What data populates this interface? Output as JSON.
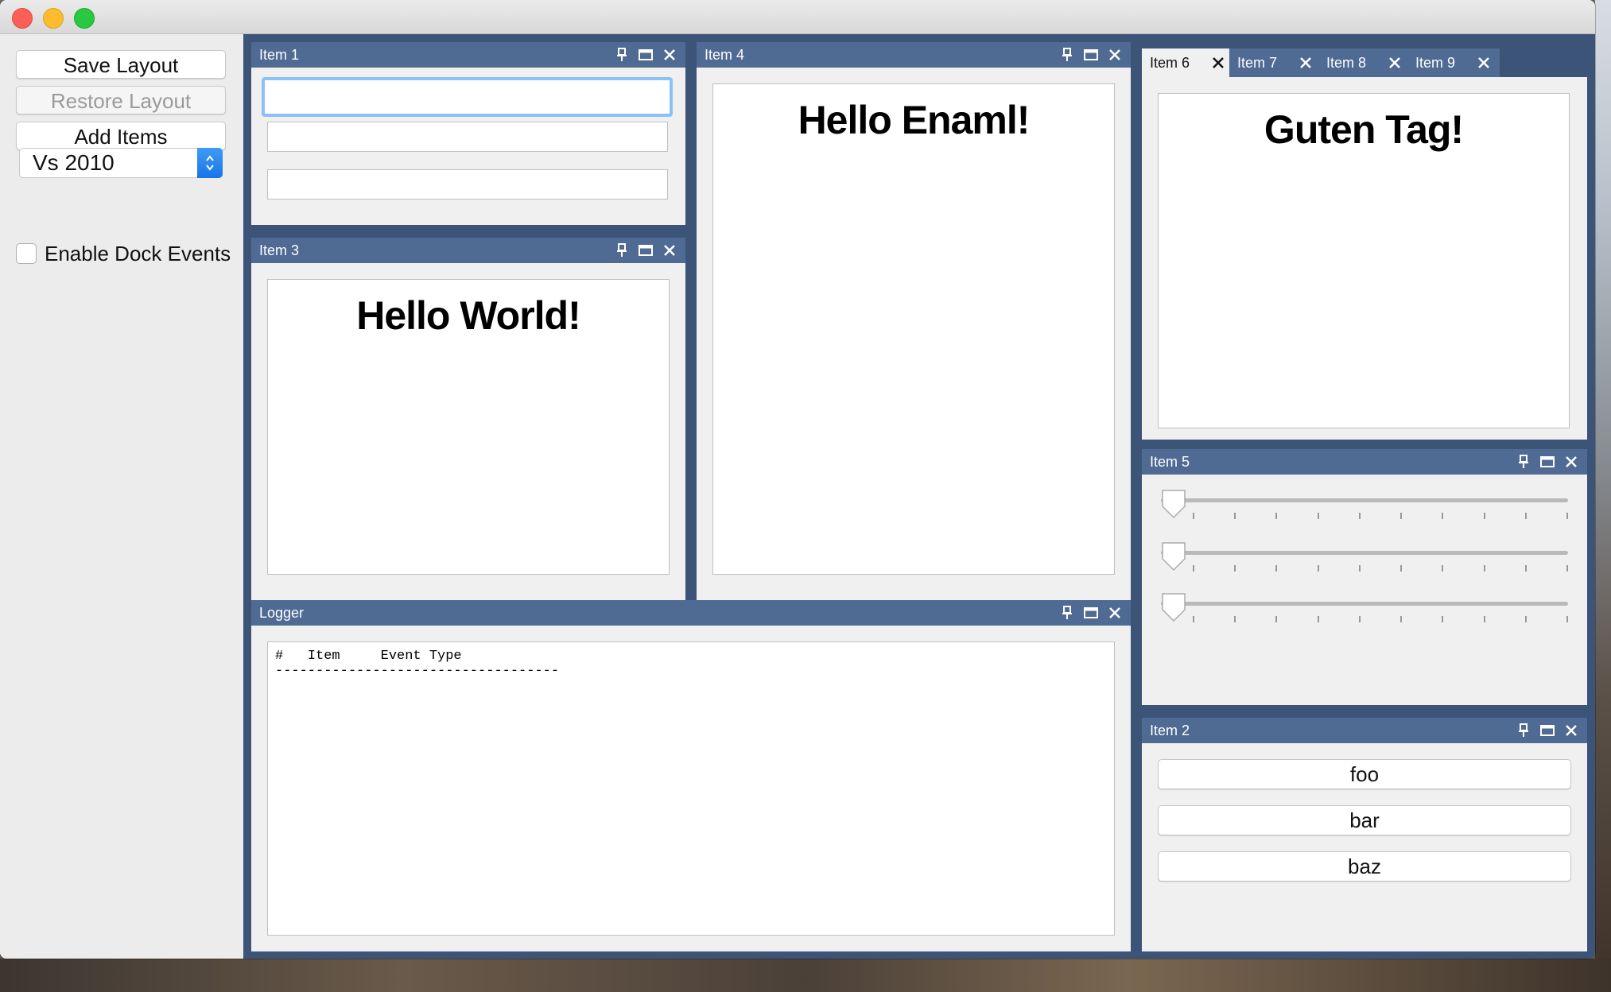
{
  "sidebar": {
    "save_label": "Save Layout",
    "restore_label": "Restore Layout",
    "add_label": "Add Items",
    "style_selected": "Vs 2010",
    "dock_events_label": "Enable Dock Events"
  },
  "panels": {
    "item1": {
      "title": "Item 1"
    },
    "item3": {
      "title": "Item 3",
      "text": "Hello World!"
    },
    "item4": {
      "title": "Item 4",
      "text": "Hello Enaml!"
    },
    "tabs": [
      "Item 6",
      "Item 7",
      "Item 8",
      "Item 9"
    ],
    "item6": {
      "text": "Guten Tag!"
    },
    "item5": {
      "title": "Item 5"
    },
    "item2": {
      "title": "Item 2",
      "buttons": [
        "foo",
        "bar",
        "baz"
      ]
    },
    "logger": {
      "title": "Logger",
      "header": "#   Item     Event Type",
      "rule": "-----------------------------------"
    }
  },
  "sliders": [
    0,
    0,
    0
  ],
  "colors": {
    "dock_bg": "#3d5479",
    "title_bg": "#4f6a93",
    "focus_ring": "#8cc1f6"
  }
}
